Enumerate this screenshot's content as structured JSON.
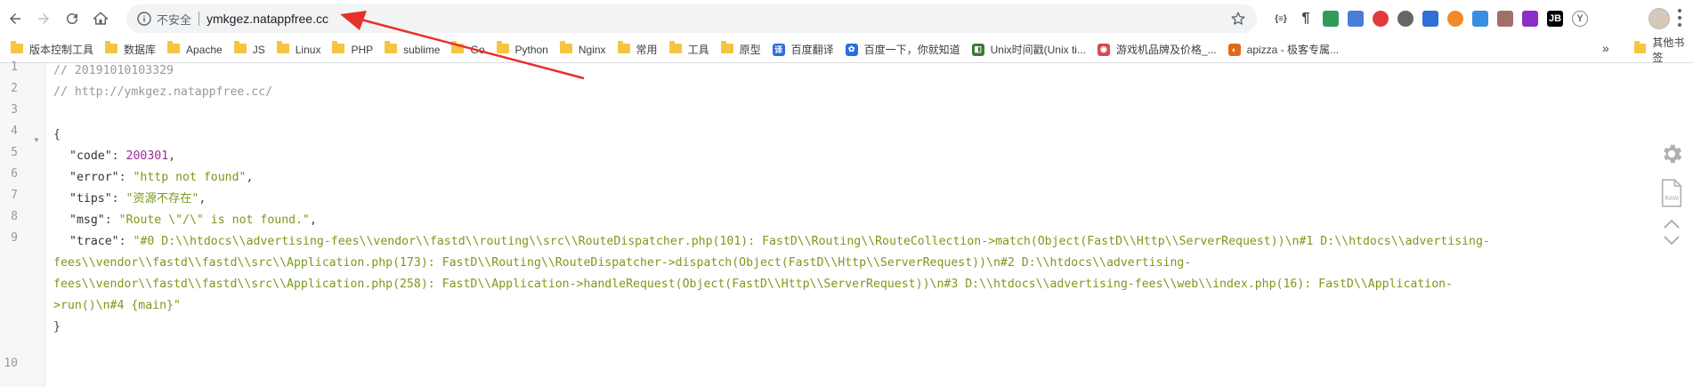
{
  "toolbar": {
    "security_label": "不安全",
    "url": "ymkgez.natappfree.cc"
  },
  "extensions": [
    {
      "icon": "json-braces-icon",
      "text": "{≡}",
      "color": "#444444"
    },
    {
      "icon": "paragraph-icon",
      "text": "¶",
      "color": "#444444"
    },
    {
      "icon": "color-picker-icon",
      "text": "",
      "color": "#2e9c5a"
    },
    {
      "icon": "rocket-icon",
      "text": "",
      "color": "#4a7bd8"
    },
    {
      "icon": "red-circle-icon",
      "text": "",
      "color": "#e03a3a"
    },
    {
      "icon": "settings-icon",
      "text": "",
      "color": "#666666"
    },
    {
      "icon": "pocket-icon",
      "text": "",
      "color": "#2f6fd6"
    },
    {
      "icon": "orange-x-icon",
      "text": "",
      "color": "#f08a2a"
    },
    {
      "icon": "blue-square-icon",
      "text": "",
      "color": "#3a8de0"
    },
    {
      "icon": "pdf-icon",
      "text": "",
      "color": "#a07068"
    },
    {
      "icon": "purple-app-icon",
      "text": "",
      "color": "#8b2fc9"
    },
    {
      "icon": "jb-icon",
      "text": "JB",
      "color": "#000000"
    },
    {
      "icon": "yoda-icon",
      "text": "Y",
      "color": "#c8c8c8"
    }
  ],
  "bookmarks": [
    {
      "type": "folder",
      "label": "版本控制工具"
    },
    {
      "type": "folder",
      "label": "数据库"
    },
    {
      "type": "folder",
      "label": "Apache"
    },
    {
      "type": "folder",
      "label": "JS"
    },
    {
      "type": "folder",
      "label": "Linux"
    },
    {
      "type": "folder",
      "label": "PHP"
    },
    {
      "type": "folder",
      "label": "sublime"
    },
    {
      "type": "folder",
      "label": "Go"
    },
    {
      "type": "folder",
      "label": "Python"
    },
    {
      "type": "folder",
      "label": "Nginx"
    },
    {
      "type": "folder",
      "label": "常用"
    },
    {
      "type": "folder",
      "label": "工具"
    },
    {
      "type": "folder",
      "label": "原型"
    },
    {
      "type": "site",
      "label": "百度翻译",
      "icon": "baidu-translate-icon",
      "color": "#2b6de3",
      "glyph": "译"
    },
    {
      "type": "site",
      "label": "百度一下，你就知道",
      "icon": "baidu-paw-icon",
      "color": "#2b6de3",
      "glyph": "✿"
    },
    {
      "type": "site",
      "label": "Unix时间戳(Unix ti...",
      "icon": "unix-timestamp-icon",
      "color": "#3a7a3a",
      "glyph": "◧"
    },
    {
      "type": "site",
      "label": "游戏机品牌及价格_...",
      "icon": "game-site-icon",
      "color": "#d64b4b",
      "glyph": "◉"
    },
    {
      "type": "site",
      "label": "apizza - 极客专属...",
      "icon": "apizza-icon",
      "color": "#e06a1a",
      "glyph": "◐"
    }
  ],
  "bookmarks_overflow": "»",
  "other_bookmarks": "其他书签",
  "code": {
    "line_numbers": [
      "1",
      "2",
      "3",
      "4",
      "5",
      "6",
      "7",
      "8",
      "9",
      "10"
    ],
    "comment1": "// 20191010103329",
    "comment2": "// http://ymkgez.natappfree.cc/",
    "open_brace": "{",
    "close_brace": "}",
    "fields": {
      "code": {
        "key": "\"code\"",
        "value": "200301"
      },
      "error": {
        "key": "\"error\"",
        "value": "\"http not found\""
      },
      "tips": {
        "key": "\"tips\"",
        "value": "\"资源不存在\""
      },
      "msg": {
        "key": "\"msg\"",
        "value": "\"Route \\\"/\\\" is not found.\""
      },
      "trace": {
        "key": "\"trace\"",
        "line1": "\"#0 D:\\\\htdocs\\\\advertising-fees\\\\vendor\\\\fastd\\\\routing\\\\src\\\\RouteDispatcher.php(101): FastD\\\\Routing\\\\RouteCollection->match(Object(FastD\\\\Http\\\\ServerRequest))\\n#1 D:\\\\htdocs\\\\advertising-",
        "line2": "fees\\\\vendor\\\\fastd\\\\fastd\\\\src\\\\Application.php(173): FastD\\\\Routing\\\\RouteDispatcher->dispatch(Object(FastD\\\\Http\\\\ServerRequest))\\n#2 D:\\\\htdocs\\\\advertising-",
        "line3": "fees\\\\vendor\\\\fastd\\\\fastd\\\\src\\\\Application.php(258): FastD\\\\Application->handleRequest(Object(FastD\\\\Http\\\\ServerRequest))\\n#3 D:\\\\htdocs\\\\advertising-fees\\\\web\\\\index.php(16): FastD\\\\Application-",
        "line4": ">run()\\n#4 {main}\""
      }
    }
  }
}
